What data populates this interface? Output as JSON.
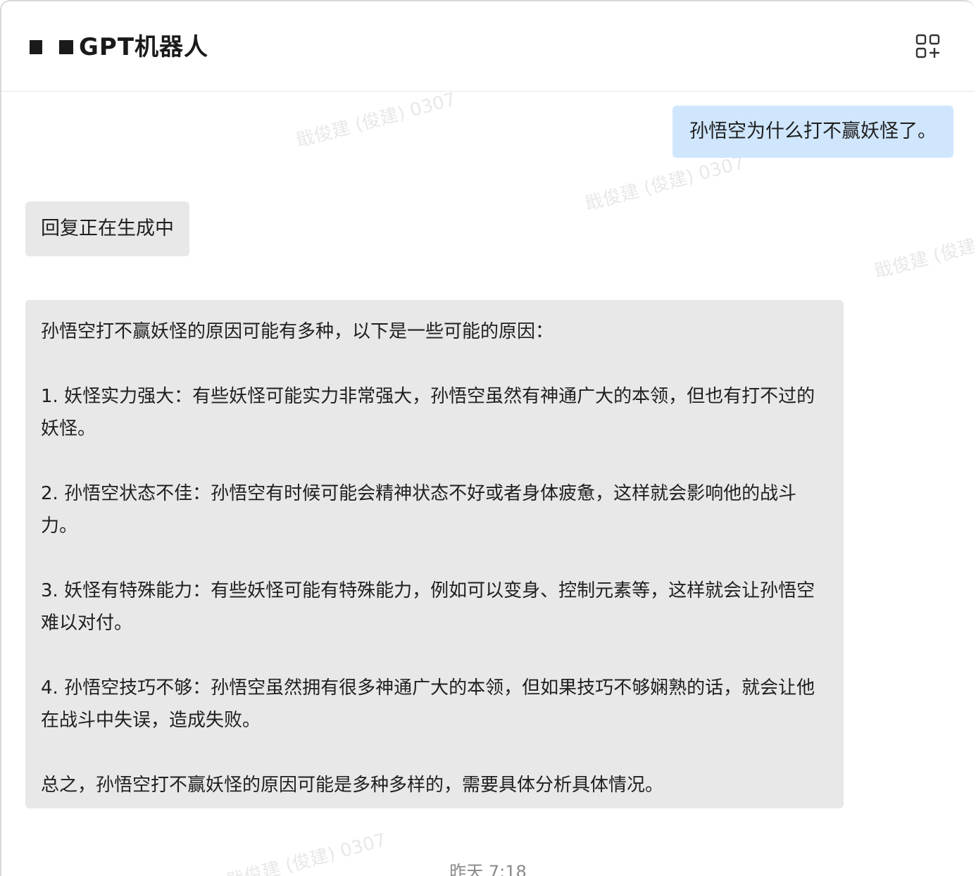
{
  "header": {
    "title": "GPT机器人",
    "app_icon": "apps-add-icon"
  },
  "watermark_text": "戢俊建 (俊建) 0307",
  "messages": {
    "user_question": "孙悟空为什么打不赢妖怪了。",
    "status": "回复正在生成中",
    "answer": [
      "孙悟空打不赢妖怪的原因可能有多种，以下是一些可能的原因：",
      "1. 妖怪实力强大：有些妖怪可能实力非常强大，孙悟空虽然有神通广大的本领，但也有打不过的妖怪。",
      "2. 孙悟空状态不佳：孙悟空有时候可能会精神状态不好或者身体疲惫，这样就会影响他的战斗力。",
      "3. 妖怪有特殊能力：有些妖怪可能有特殊能力，例如可以变身、控制元素等，这样就会让孙悟空难以对付。",
      "4. 孙悟空技巧不够：孙悟空虽然拥有很多神通广大的本领，但如果技巧不够娴熟的话，就会让他在战斗中失误，造成失败。",
      "总之，孙悟空打不赢妖怪的原因可能是多种多样的，需要具体分析具体情况。"
    ]
  },
  "timestamp": "昨天 7:18",
  "colors": {
    "user_bubble": "#cfe6fd",
    "bot_bubble": "#e8e8e8"
  }
}
